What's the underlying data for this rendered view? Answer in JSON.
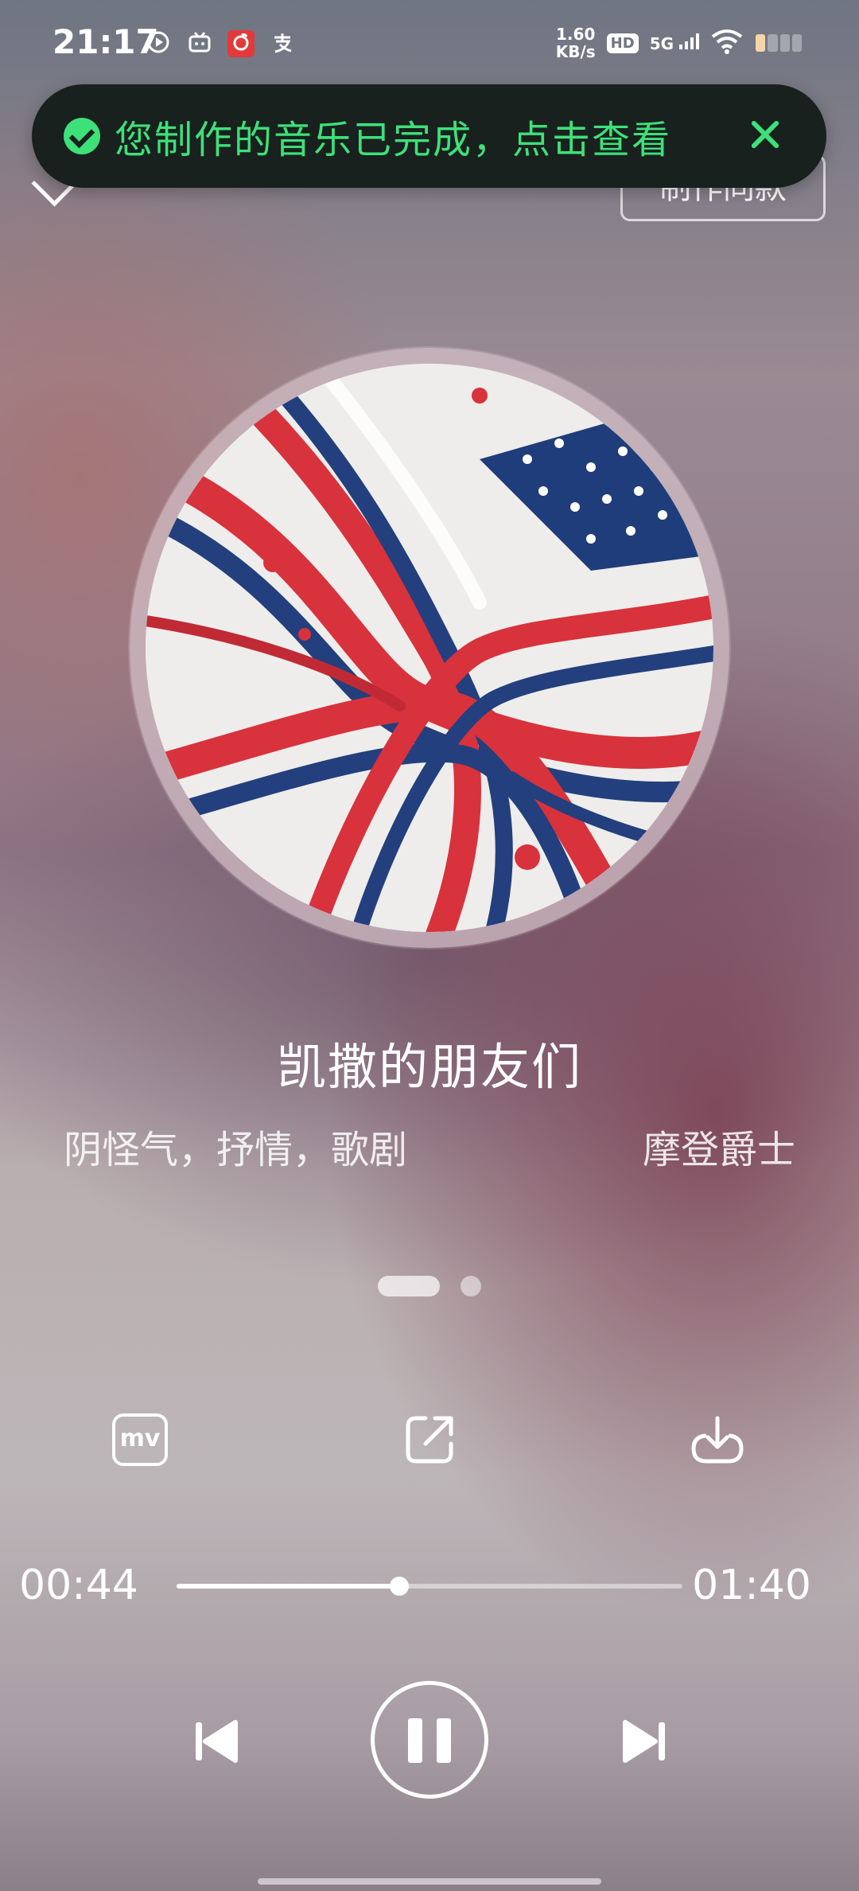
{
  "status_bar": {
    "time": "21:17",
    "net_speed_value": "1.60",
    "net_speed_unit": "KB/s",
    "hd_label": "HD",
    "network": "5G",
    "app_icons": [
      "play-circle-icon",
      "bilibili-icon",
      "netease-music-icon",
      "alipay-icon"
    ],
    "battery_segments_on": 1,
    "battery_segments_total": 4
  },
  "header": {
    "make_same_label": "制作同款"
  },
  "toast": {
    "message": "您制作的音乐已完成，点击查看",
    "accent": "#3ee07a"
  },
  "song": {
    "title": "凯撒的朋友们",
    "tags": "阴怪气，抒情，歌剧",
    "artist": "摩登爵士"
  },
  "actions": {
    "mv_label": "mv"
  },
  "player": {
    "current_time": "00:44",
    "total_time": "01:40",
    "progress": 0.44
  }
}
